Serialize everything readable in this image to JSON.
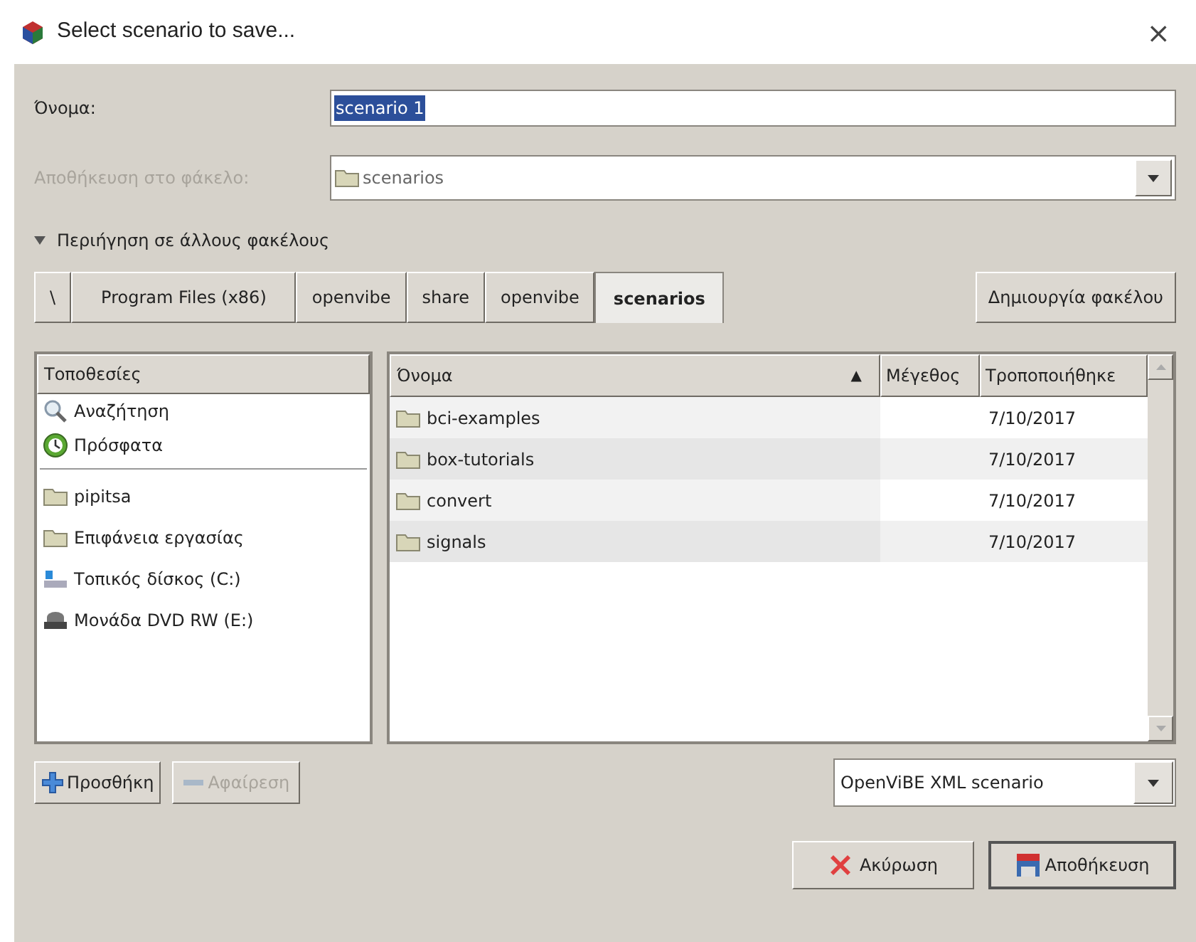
{
  "window": {
    "title": "Select scenario to save...",
    "close": "×"
  },
  "name_field": {
    "label": "Όνομα:",
    "value": "scenario 1",
    "text_selected": true
  },
  "folder_field": {
    "label": "Αποθήκευση στο φάκελο:",
    "value": "scenarios",
    "disabled": true
  },
  "browse_expander": {
    "label": "Περιήγηση σε άλλους φακέλους",
    "expanded": true
  },
  "path_bar": [
    {
      "label": "\\",
      "selected": false
    },
    {
      "label": "Program Files (x86)",
      "selected": false
    },
    {
      "label": "openvibe",
      "selected": false
    },
    {
      "label": "share",
      "selected": false
    },
    {
      "label": "openvibe",
      "selected": false
    },
    {
      "label": "scenarios",
      "selected": true
    }
  ],
  "create_folder_button": "Δημιουργία φακέλου",
  "sidebar": {
    "heading": "Τοποθεσίες",
    "shortcuts": [
      {
        "label": "Αναζήτηση",
        "kind": "search"
      },
      {
        "label": "Πρόσφατα",
        "kind": "recent"
      }
    ],
    "bookmarks": [
      {
        "label": "pipitsa",
        "kind": "folder"
      },
      {
        "label": "Επιφάνεια εργασίας",
        "kind": "folder"
      },
      {
        "label": "Τοπικός δίσκος (C:)",
        "kind": "drive"
      },
      {
        "label": "Μονάδα DVD RW (E:)",
        "kind": "dvd"
      }
    ]
  },
  "table": {
    "columns": [
      "Όνομα",
      "Μέγεθος",
      "Τροποποιήθηκε"
    ],
    "sort_indicator": "▲",
    "rows": [
      {
        "name": "bci-examples",
        "modified": "7/10/2017"
      },
      {
        "name": "box-tutorials",
        "modified": "7/10/2017"
      },
      {
        "name": "convert",
        "modified": "7/10/2017"
      },
      {
        "name": "signals",
        "modified": "7/10/2017"
      }
    ]
  },
  "add_button": {
    "label": "Προσθήκη",
    "disabled": false
  },
  "remove_button": {
    "label": "Αφαίρεση",
    "disabled": true
  },
  "filter_select": {
    "value": "OpenViBE XML scenario"
  },
  "cancel_button": "Ακύρωση",
  "save_button": "Αποθήκευση"
}
